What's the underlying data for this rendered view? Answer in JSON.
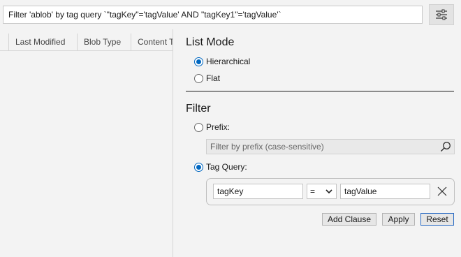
{
  "search": {
    "text": "Filter 'ablob' by tag query `\"tagKey\"='tagValue' AND \"tagKey1\"='tagValue'`"
  },
  "table": {
    "columns": [
      "Last Modified",
      "Blob Type",
      "Content T"
    ]
  },
  "list_mode": {
    "title": "List Mode",
    "options": [
      {
        "label": "Hierarchical",
        "checked": true
      },
      {
        "label": "Flat",
        "checked": false
      }
    ]
  },
  "filter": {
    "title": "Filter",
    "prefix_label": "Prefix:",
    "prefix_placeholder": "Filter by prefix (case-sensitive)",
    "tag_query_label": "Tag Query:",
    "clause": {
      "key": "tagKey",
      "operator": "=",
      "value": "tagValue"
    },
    "buttons": {
      "add_clause": "Add Clause",
      "apply": "Apply",
      "reset": "Reset"
    }
  },
  "colors": {
    "accent": "#0067c0",
    "focus_border": "#2b6cc4"
  },
  "icons": {
    "filter_toggle": "sliders-icon",
    "prefix_search": "search-icon",
    "remove_clause": "close-icon",
    "operator_dropdown": "chevron-down-icon"
  }
}
